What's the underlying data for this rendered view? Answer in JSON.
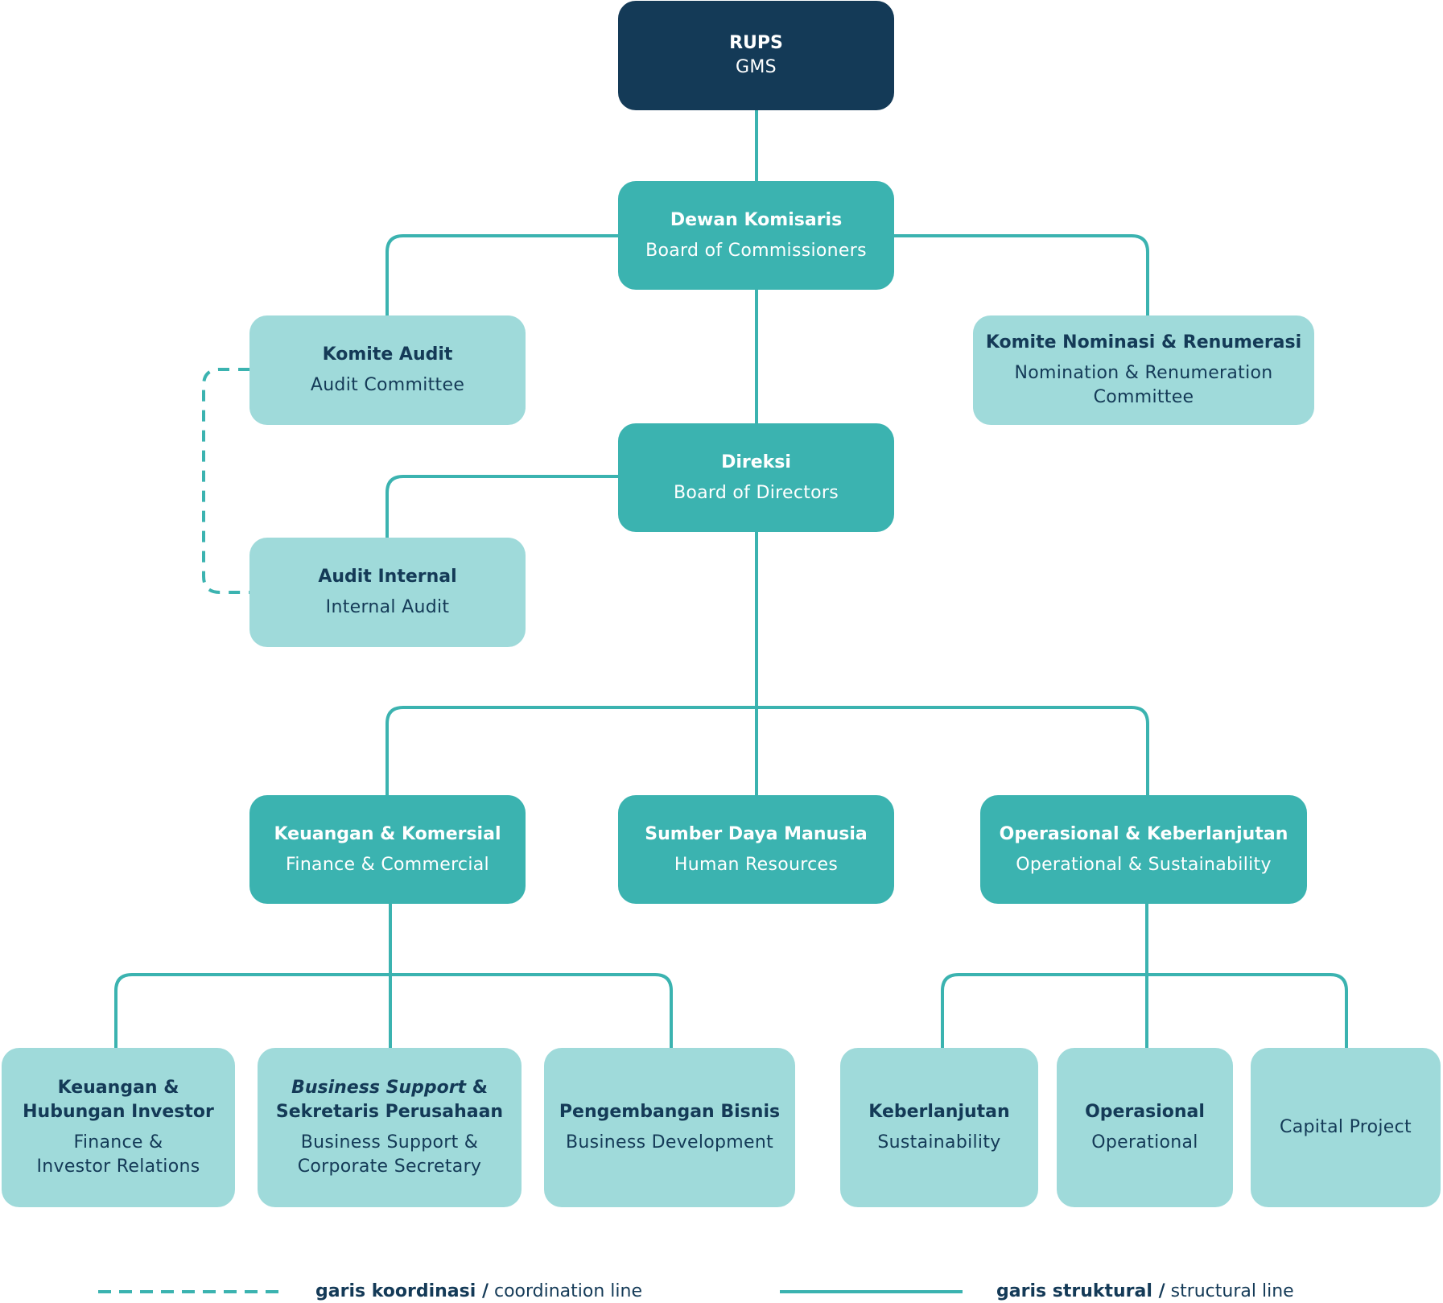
{
  "colors": {
    "top": "#143a57",
    "mid": "#3bb3b0",
    "light": "#9fdada",
    "line": "#3bb3b0",
    "text_dark": "#143a57",
    "text_light": "#ffffff"
  },
  "nodes": {
    "rups": {
      "title": "RUPS",
      "subtitle": "GMS"
    },
    "dewan_komisaris": {
      "title": "Dewan Komisaris",
      "subtitle": "Board of Commissioners"
    },
    "komite_audit": {
      "title": "Komite Audit",
      "subtitle": "Audit Committee"
    },
    "komite_nominasi": {
      "title": "Komite Nominasi & Renumerasi",
      "subtitle_line1": "Nomination & Renumeration",
      "subtitle_line2": "Committee"
    },
    "direksi": {
      "title": "Direksi",
      "subtitle": "Board of Directors"
    },
    "audit_internal": {
      "title": "Audit Internal",
      "subtitle": "Internal Audit"
    },
    "keuangan_komersial": {
      "title": "Keuangan & Komersial",
      "subtitle": "Finance & Commercial"
    },
    "sdm": {
      "title": "Sumber Daya Manusia",
      "subtitle": "Human Resources"
    },
    "operasional_keberlanjutan": {
      "title": "Operasional & Keberlanjutan",
      "subtitle": "Operational & Sustainability"
    },
    "keuangan_hubungan_investor": {
      "title_line1": "Keuangan &",
      "title_line2": "Hubungan Investor",
      "subtitle_line1": "Finance &",
      "subtitle_line2": "Investor Relations"
    },
    "business_support": {
      "title_italic": "Business Support",
      "title_rest": " &",
      "title_line2": "Sekretaris Perusahaan",
      "subtitle_line1": "Business Support &",
      "subtitle_line2": "Corporate Secretary"
    },
    "pengembangan_bisnis": {
      "title": "Pengembangan Bisnis",
      "subtitle": "Business Development"
    },
    "keberlanjutan": {
      "title": "Keberlanjutan",
      "subtitle": "Sustainability"
    },
    "operasional": {
      "title": "Operasional",
      "subtitle": "Operational"
    },
    "capital_project": {
      "subtitle": "Capital Project"
    }
  },
  "legend": {
    "coordination": {
      "bold": "garis koordinasi /",
      "normal": " coordination line"
    },
    "structural": {
      "bold": "garis struktural /",
      "normal": " structural line"
    }
  }
}
